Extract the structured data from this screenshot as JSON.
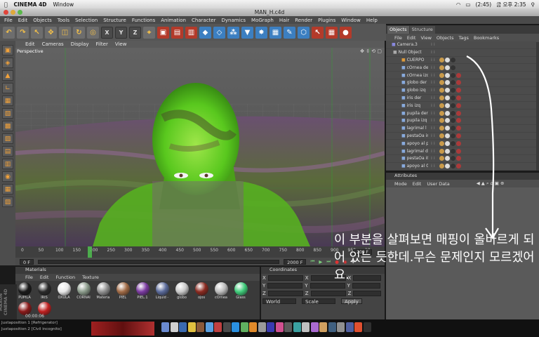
{
  "mac_menubar": {
    "app": "CINEMA 4D",
    "menus": [
      "Window"
    ],
    "battery": "(2:45)",
    "clock": "금 오후 2:35"
  },
  "window_title": "MAN_H.c4d",
  "app_menu": [
    "File",
    "Edit",
    "Objects",
    "Tools",
    "Selection",
    "Structure",
    "Functions",
    "Animation",
    "Character",
    "Dynamics",
    "MoGraph",
    "Hair",
    "Render",
    "Plugins",
    "Window",
    "Help"
  ],
  "toolbar": {
    "axis_x": "X",
    "axis_y": "Y",
    "axis_z": "Z"
  },
  "viewport": {
    "menu": [
      "Edit",
      "Cameras",
      "Display",
      "Filter",
      "View"
    ],
    "label": "Perspective"
  },
  "timeline": {
    "ticks": [
      "0",
      "50",
      "100",
      "150",
      "200",
      "250",
      "300",
      "350",
      "400",
      "450",
      "500",
      "550",
      "600",
      "650",
      "700",
      "750",
      "800",
      "850",
      "900",
      "950",
      "10"
    ],
    "current_frame": "209 F",
    "start_frame": "0 F",
    "end_frame": "2000 F"
  },
  "materials": {
    "header": "Materials",
    "menu": [
      "File",
      "Edit",
      "Function",
      "Texture"
    ],
    "items": [
      {
        "name": "PUPILA",
        "color": "#1a1a1a"
      },
      {
        "name": "IRIS",
        "color": "#2a2a2a"
      },
      {
        "name": "OXULA",
        "color": "#e8e8e8"
      },
      {
        "name": "CORNAI",
        "color": "#8a9a8a"
      },
      {
        "name": "Materia",
        "color": "#909090"
      },
      {
        "name": "PIEL",
        "color": "#a06a45"
      },
      {
        "name": "PIEL.1",
        "color": "#7a3aa0"
      },
      {
        "name": "Liquid -",
        "color": "#5a6a9a"
      },
      {
        "name": "globo",
        "color": "#c8c8c8"
      },
      {
        "name": "ojos",
        "color": "#8a2a20"
      },
      {
        "name": "cOrnea",
        "color": "#bbbbbb"
      },
      {
        "name": "Glass",
        "color": "#3fcc7a"
      }
    ],
    "timecode": "00:00:06"
  },
  "coordinates": {
    "header": "Coordinates",
    "rows": [
      "X",
      "Y",
      "Z"
    ],
    "mode": "World",
    "scale": "Scale",
    "apply": "Apply"
  },
  "objects_panel": {
    "tabs": [
      "Objects",
      "Structure"
    ],
    "menu": [
      "File",
      "Edit",
      "View",
      "Objects",
      "Tags",
      "Bookmarks"
    ],
    "items": [
      {
        "name": "Camera.3",
        "color": "#8888dd"
      },
      {
        "name": "Null Object",
        "color": "#aaaaaa"
      },
      {
        "name": "CUERPO",
        "color": "#dd9a3a"
      },
      {
        "name": "cOrnea der",
        "color": "#88aadd"
      },
      {
        "name": "cOrnea izq",
        "color": "#88aadd"
      },
      {
        "name": "globo der",
        "color": "#88aadd"
      },
      {
        "name": "globo izq",
        "color": "#88aadd"
      },
      {
        "name": "iris der",
        "color": "#88aadd"
      },
      {
        "name": "iris izq",
        "color": "#88aadd"
      },
      {
        "name": "pupila der",
        "color": "#88aadd"
      },
      {
        "name": "pupila izq",
        "color": "#88aadd"
      },
      {
        "name": "lagrimal l",
        "color": "#88aadd"
      },
      {
        "name": "pestaÕa in",
        "color": "#88aadd"
      },
      {
        "name": "apoyo al p",
        "color": "#88aadd"
      },
      {
        "name": "lagrimal d",
        "color": "#88aadd"
      },
      {
        "name": "pestaÕa i0",
        "color": "#88aadd"
      },
      {
        "name": "apoyo al 0",
        "color": "#88aadd"
      }
    ]
  },
  "attributes_panel": {
    "header": "Attributes",
    "menu": [
      "Mode",
      "Edit",
      "User Data"
    ]
  },
  "maxon_logo": "MAXON CINEMA 4D",
  "taskbar": [
    "Juxtaposition 1 [Refrigerator]",
    "Juxtaposition 2 [Civil incognito]"
  ],
  "annotation": "이 부분을 살펴보면 매핑이 올바르게 되어 있는 듯한데.무슨 문제인지 모르겠어요."
}
